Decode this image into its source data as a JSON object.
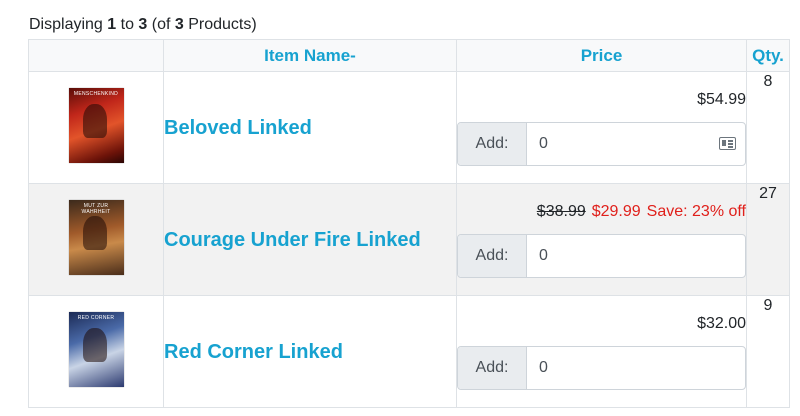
{
  "listing": {
    "prefix": "Displaying ",
    "from": "1",
    "to_word": " to ",
    "to": "3",
    "of_word": " (of ",
    "total": "3",
    "suffix": " Products)"
  },
  "headers": {
    "image": "",
    "item_name": "Item Name-",
    "price": "Price",
    "qty": "Qty."
  },
  "products": [
    {
      "name": "Beloved Linked",
      "image_caption": "MENSCHENKIND",
      "price": "$54.99",
      "old_price": "",
      "special_price": "",
      "save": "",
      "add_label": "Add:",
      "add_value": "0",
      "qty": "8"
    },
    {
      "name": "Courage Under Fire Linked",
      "image_caption": "MUT ZUR WAHRHEIT",
      "price": "",
      "old_price": "$38.99",
      "special_price": "$29.99",
      "save": "Save: 23% off",
      "add_label": "Add:",
      "add_value": "0",
      "qty": "27"
    },
    {
      "name": "Red Corner Linked",
      "image_caption": "RED CORNER",
      "price": "$32.00",
      "old_price": "",
      "special_price": "",
      "save": "",
      "add_label": "Add:",
      "add_value": "0",
      "qty": "9"
    }
  ],
  "colors": {
    "link": "#17a2d0",
    "special": "#e0201b",
    "header_bg": "#f8f9fa",
    "alt_row_bg": "#f2f2f2"
  },
  "icons": {
    "autofill": "contact-card-icon"
  }
}
